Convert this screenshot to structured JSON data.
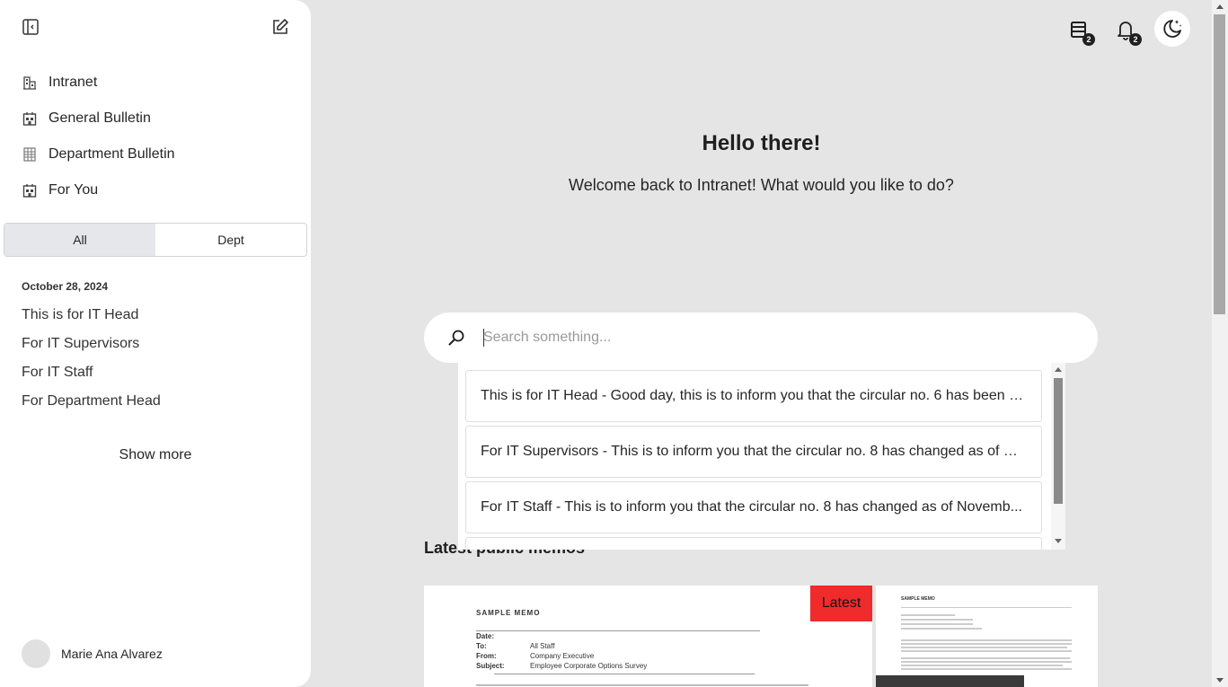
{
  "sidebar": {
    "nav": [
      {
        "label": "Intranet",
        "icon": "building-icon"
      },
      {
        "label": "General Bulletin",
        "icon": "calendar-building-icon"
      },
      {
        "label": "Department Bulletin",
        "icon": "grid-building-icon"
      },
      {
        "label": "For You",
        "icon": "calendar-building-icon"
      }
    ],
    "tabs": [
      "All",
      "Dept"
    ],
    "date_heading": "October 28, 2024",
    "memos": [
      "This is for IT Head",
      "For IT Supervisors",
      "For IT Staff",
      "For Department Head"
    ],
    "show_more": "Show more",
    "user_name": "Marie Ana Alvarez"
  },
  "header": {
    "memos_badge": "2",
    "notifications_badge": "2"
  },
  "main": {
    "greeting": "Hello there!",
    "welcome": "Welcome back to Intranet! What would you like to do?",
    "search_placeholder": "Search something...",
    "suggestions": [
      "This is for IT Head - Good day, this is to inform you that the circular no. 6 has been u...",
      "For IT Supervisors - This is to inform you that the circular no. 8 has changed as of No...",
      "For IT Staff - This is to inform you that the circular no. 8 has changed as of Novemb..."
    ],
    "latest_title": "Latest public memos",
    "latest_badge": "Latest",
    "card1": {
      "heading": "SAMPLE MEMO",
      "date_label": "Date:",
      "to_label": "To:",
      "to_value": "All Staff",
      "from_label": "From:",
      "from_value": "Company Executive",
      "subject_label": "Subject:",
      "subject_value": "Employee Corporate Options Survey"
    },
    "card2": {
      "heading": "SAMPLE MEMO"
    }
  }
}
